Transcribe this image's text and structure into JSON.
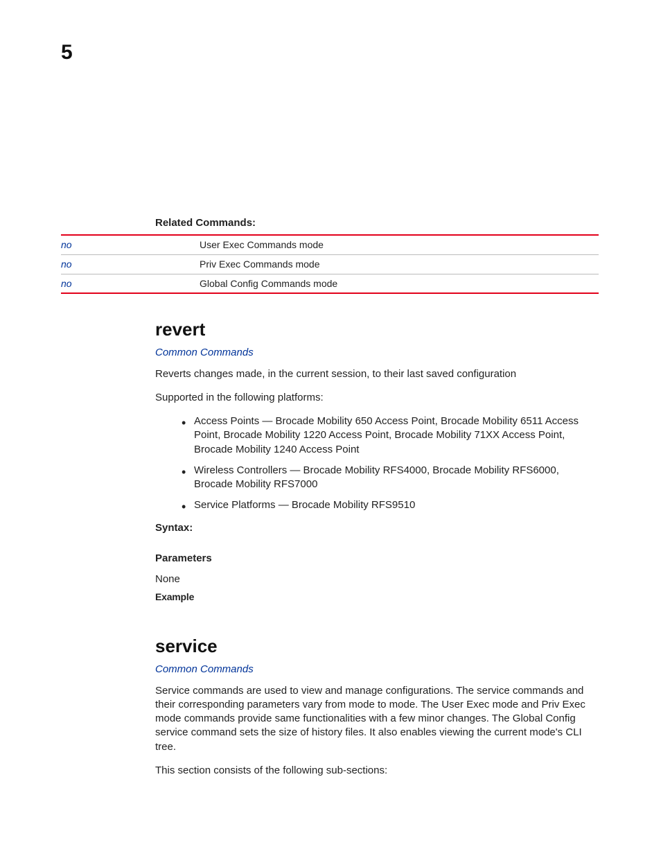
{
  "chapter_number": "5",
  "related_commands": {
    "heading": "Related Commands:",
    "rows": [
      {
        "link": "no",
        "desc": "User Exec Commands mode"
      },
      {
        "link": "no",
        "desc": "Priv Exec Commands mode"
      },
      {
        "link": "no",
        "desc": "Global Config Commands mode"
      }
    ]
  },
  "revert": {
    "title": "revert",
    "common_link": "Common Commands",
    "desc": "Reverts changes made, in the current session, to their last saved configuration",
    "supported_intro": "Supported in the following platforms:",
    "platforms": [
      "Access Points — Brocade Mobility 650 Access Point, Brocade Mobility 6511 Access Point, Brocade Mobility 1220 Access Point, Brocade Mobility 71XX Access Point, Brocade Mobility 1240 Access Point",
      "Wireless Controllers — Brocade Mobility RFS4000, Brocade Mobility RFS6000, Brocade Mobility RFS7000",
      "Service Platforms — Brocade Mobility RFS9510"
    ],
    "syntax_label": "Syntax:",
    "parameters_label": "Parameters",
    "parameters_value": "None",
    "example_label": "Example"
  },
  "service": {
    "title": "service",
    "common_link": "Common Commands",
    "desc": "Service commands are used to view and manage configurations. The service commands and their corresponding parameters vary from mode to mode. The User Exec mode and Priv Exec mode commands provide same functionalities with a few minor changes. The Global Config service command sets the size of history files. It also enables viewing the current mode's CLI tree.",
    "subsections_intro": "This section consists of the following sub-sections:"
  }
}
